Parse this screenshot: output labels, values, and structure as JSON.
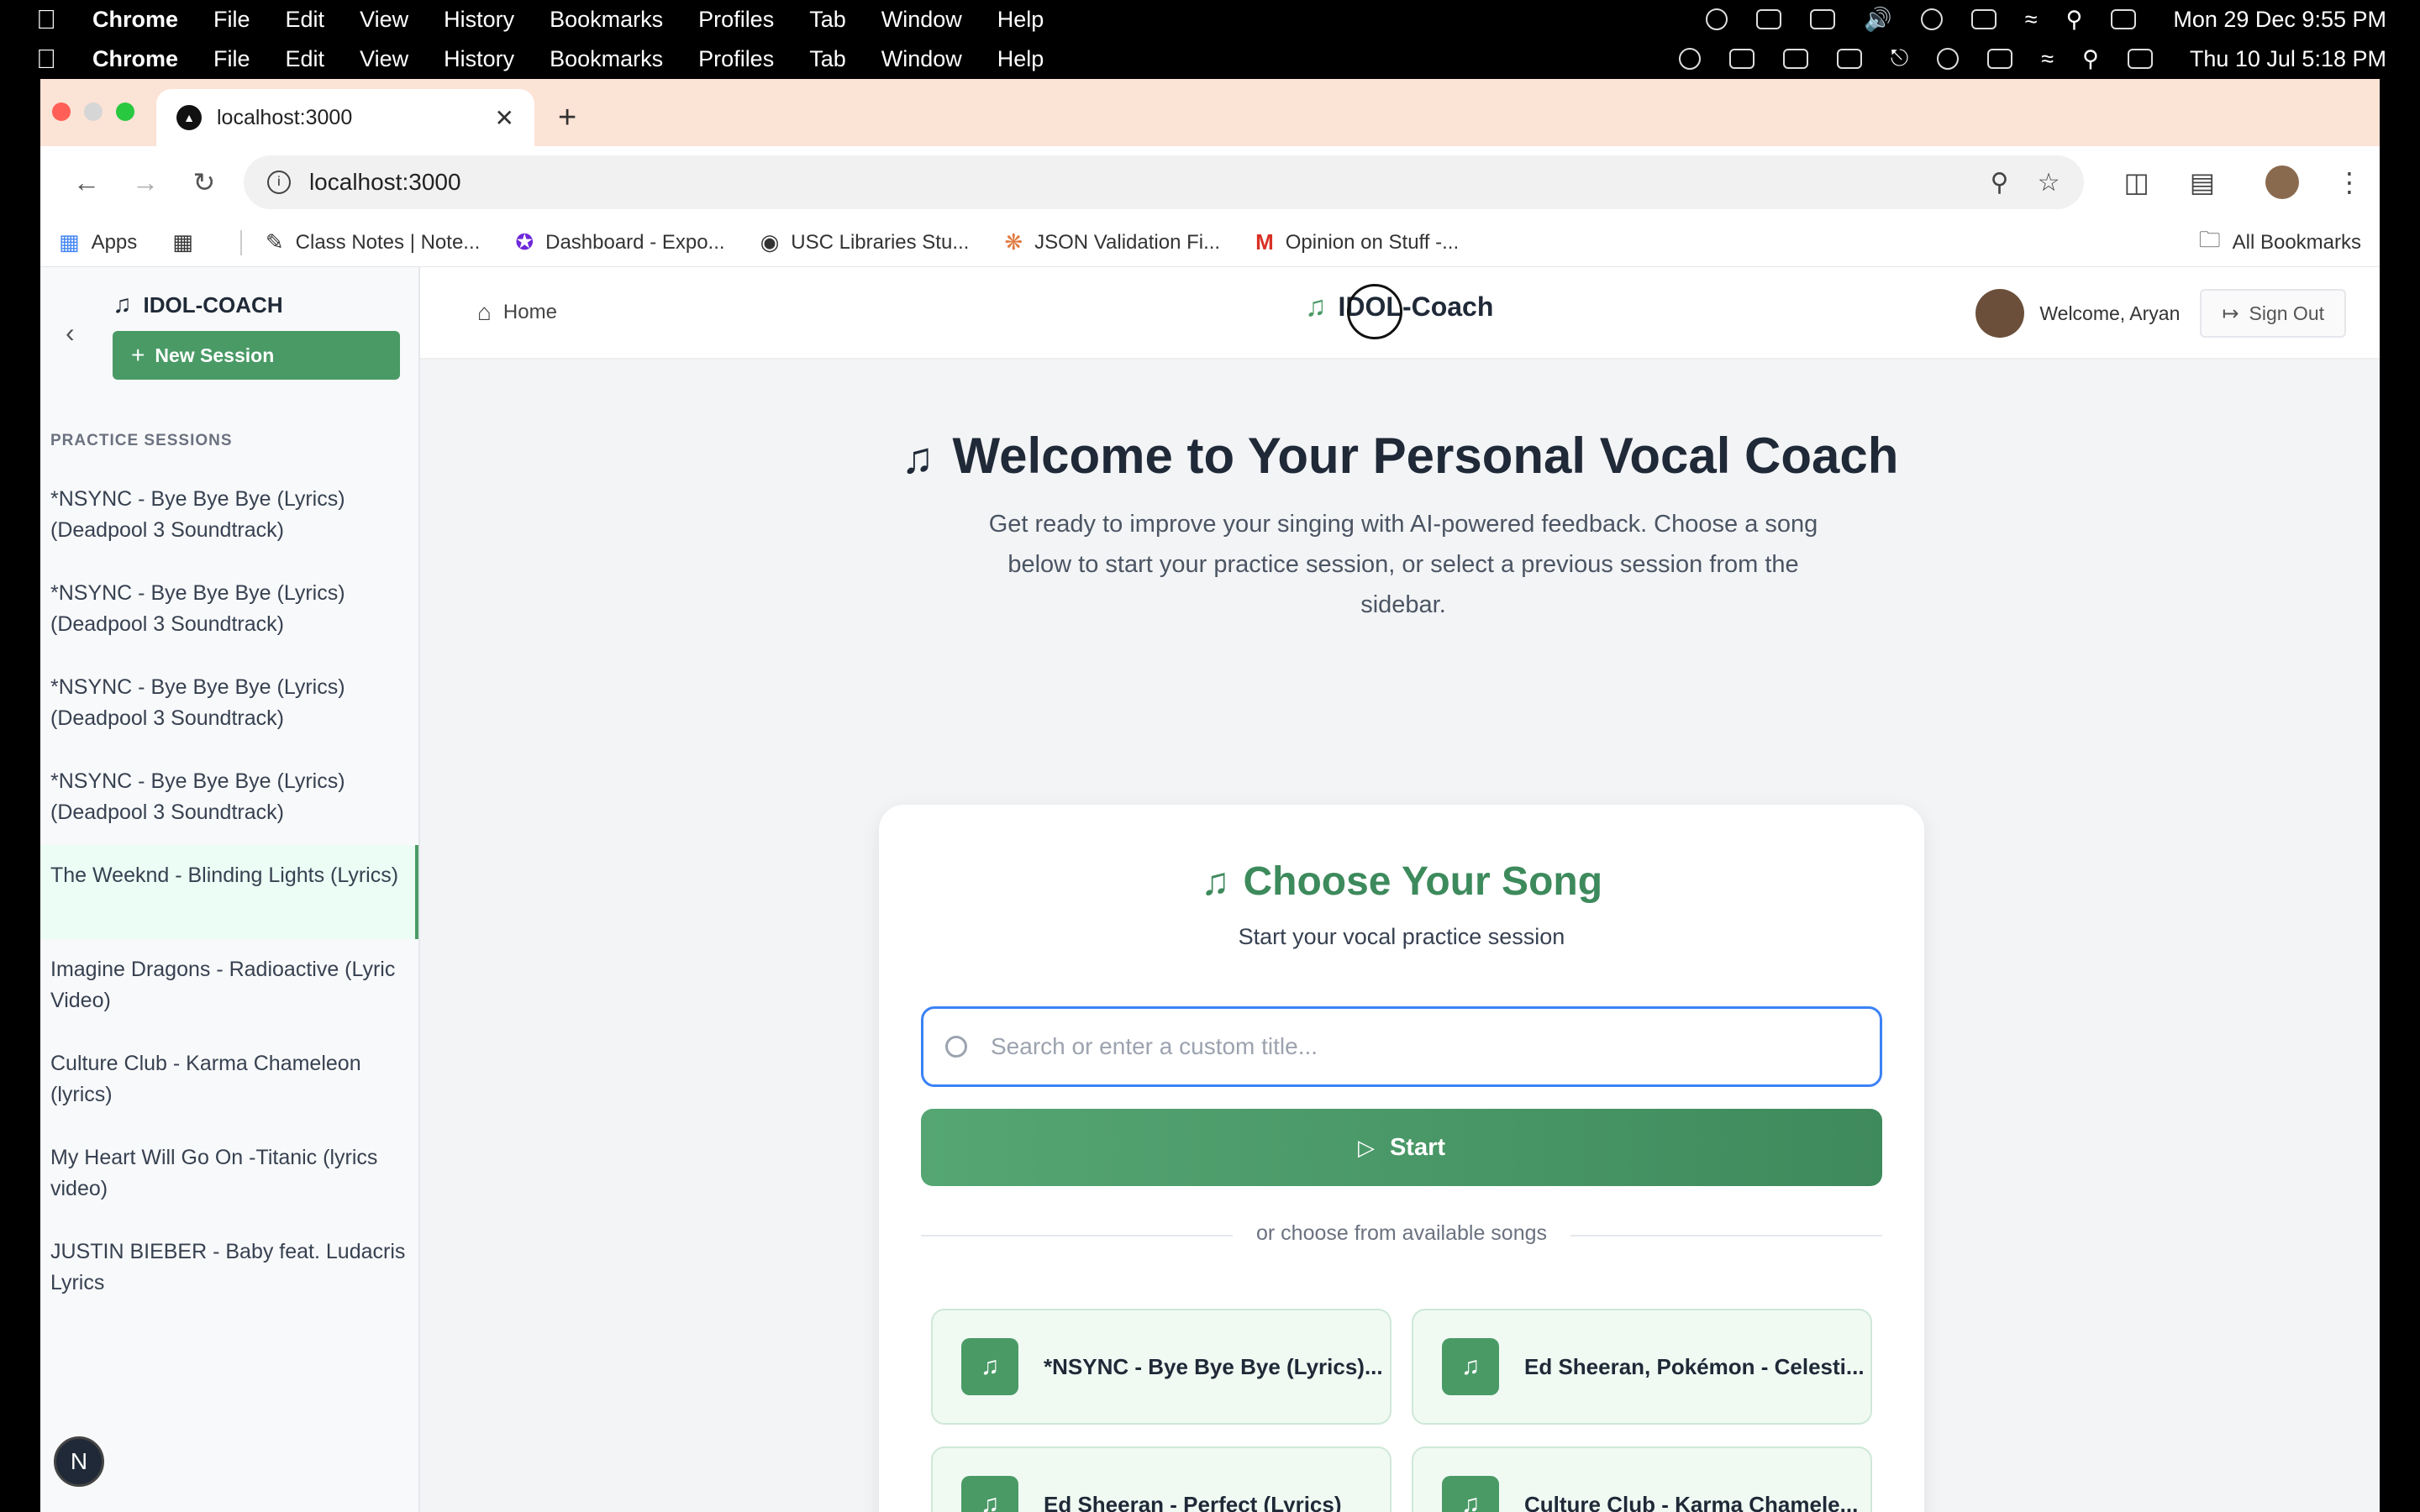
{
  "menubar_top": {
    "app": "Chrome",
    "menus": [
      "File",
      "Edit",
      "View",
      "History",
      "Bookmarks",
      "Profiles",
      "Tab",
      "Window",
      "Help"
    ],
    "clock": "Mon 29 Dec  9:55 PM"
  },
  "menubar_second": {
    "app": "Chrome",
    "menus": [
      "File",
      "Edit",
      "View",
      "History",
      "Bookmarks",
      "Profiles",
      "Tab",
      "Window",
      "Help"
    ],
    "clock": "Thu 10 Jul  5:18 PM"
  },
  "browser": {
    "tab_title": "localhost:3000",
    "url": "localhost:3000",
    "bookmarks": [
      {
        "label": "Apps",
        "icon": "apps-grid-icon"
      },
      {
        "label": "Class Notes | Note...",
        "icon": "pencil-icon"
      },
      {
        "label": "Dashboard - Expo...",
        "icon": "expo-icon"
      },
      {
        "label": "USC Libraries Stu...",
        "icon": "globe-icon"
      },
      {
        "label": "JSON Validation Fi...",
        "icon": "sunburst-icon"
      },
      {
        "label": "Opinion on Stuff -...",
        "icon": "gmail-icon"
      }
    ],
    "all_bookmarks": "All Bookmarks"
  },
  "sidebar": {
    "brand": "IDOL-COACH",
    "new_session": "New Session",
    "section_label": "PRACTICE SESSIONS",
    "sessions": [
      "*NSYNC - Bye Bye Bye (Lyrics) (Deadpool 3 Soundtrack)",
      "*NSYNC - Bye Bye Bye (Lyrics) (Deadpool 3 Soundtrack)",
      "*NSYNC - Bye Bye Bye (Lyrics) (Deadpool 3 Soundtrack)",
      "*NSYNC - Bye Bye Bye (Lyrics) (Deadpool 3 Soundtrack)",
      "The Weeknd - Blinding Lights (Lyrics)",
      "Imagine Dragons - Radioactive (Lyric Video)",
      "Culture Club - Karma Chameleon (lyrics)",
      "My Heart Will Go On -Titanic (lyrics video)",
      "JUSTIN BIEBER - Baby feat. Ludacris Lyrics"
    ],
    "active_index": 4,
    "badge": "N"
  },
  "topnav": {
    "home": "Home",
    "logo": "IDOL-Coach",
    "welcome": "Welcome, Aryan",
    "sign_out": "Sign Out"
  },
  "hero": {
    "title": "Welcome to Your Personal Vocal Coach",
    "description": "Get ready to improve your singing with AI-powered feedback. Choose a song below to start your practice session, or select a previous session from the sidebar."
  },
  "card": {
    "title": "Choose Your Song",
    "subtitle": "Start your vocal practice session",
    "search_placeholder": "Search or enter a custom title...",
    "start": "Start",
    "divider": "or choose from available songs",
    "songs": [
      "*NSYNC - Bye Bye Bye (Lyrics)...",
      "Ed Sheeran, Pokémon - Celesti...",
      "Ed Sheeran - Perfect (Lyrics)",
      "Culture Club - Karma Chamele..."
    ]
  },
  "colors": {
    "accent_green": "#4a9a66",
    "tab_strip": "#fbe3d6",
    "search_focus": "#3b82f6"
  }
}
